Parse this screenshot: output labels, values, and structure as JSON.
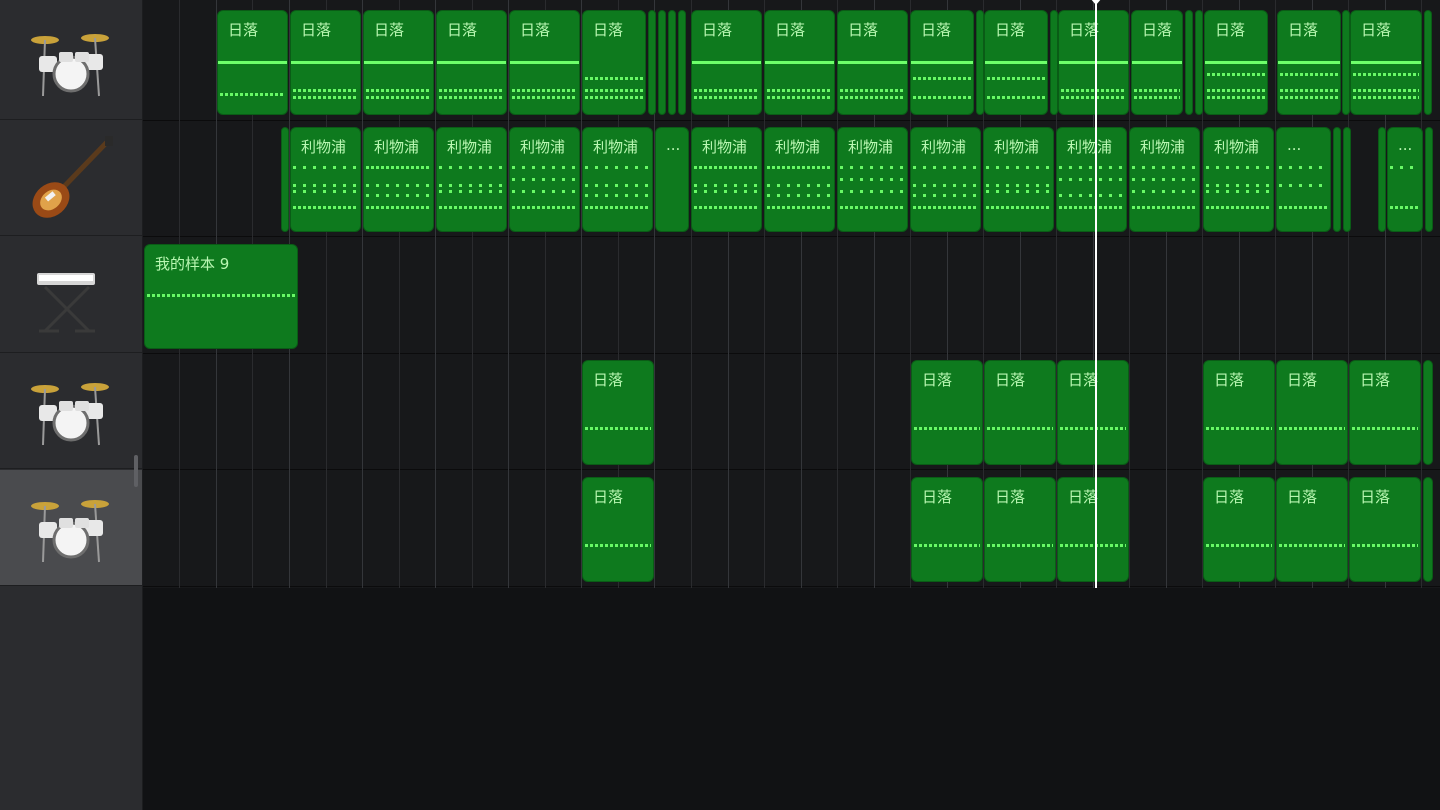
{
  "tracks": [
    {
      "instrument": "drum-kit",
      "icon": "drum-kit-icon",
      "selected": false
    },
    {
      "instrument": "bass-guitar",
      "icon": "bass-guitar-icon",
      "selected": false
    },
    {
      "instrument": "keyboard",
      "icon": "keyboard-icon",
      "selected": false
    },
    {
      "instrument": "drum-kit",
      "icon": "drum-kit-icon",
      "selected": false
    },
    {
      "instrument": "drum-kit",
      "icon": "drum-kit-icon",
      "selected": true
    }
  ],
  "region_labels": {
    "sunset": "日落",
    "liverpool": "利物浦",
    "sample": "我的样本 9",
    "ellipsis": "..."
  },
  "colors": {
    "region_fill": "#0e7a1e",
    "region_text": "#b9f7b2",
    "note_color": "#6dff6a",
    "playhead": "#ffffff"
  }
}
